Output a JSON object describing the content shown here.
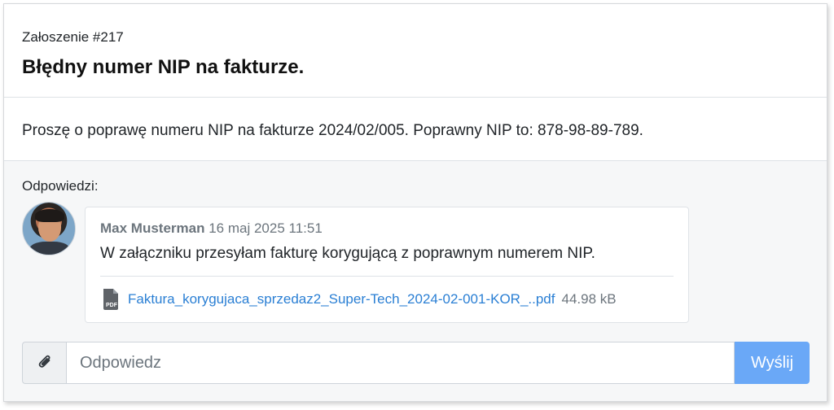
{
  "ticket": {
    "number": "Załoszenie #217",
    "title": "Błędny numer NIP na fakturze.",
    "body": "Proszę o poprawę numeru NIP na fakturze 2024/02/005. Poprawny NIP to: 878-98-89-789."
  },
  "replies": {
    "label": "Odpowiedzi:",
    "items": [
      {
        "author": "Max Musterman",
        "date": "16 maj 2025 11:51",
        "text": "W załączniku przesyłam fakturę korygującą z poprawnym numerem NIP.",
        "attachment": {
          "icon": "pdf-file-icon",
          "filename": "Faktura_korygujaca_sprzedaz2_Super-Tech_2024-02-001-KOR_..pdf",
          "size": "44.98 kB"
        }
      }
    ]
  },
  "reply_form": {
    "attach_icon": "paperclip-icon",
    "placeholder": "Odpowiedz",
    "value": "",
    "send_label": "Wyślij"
  },
  "colors": {
    "accent": "#6aa8f7",
    "link": "#2a7fd4",
    "muted": "#6c757d",
    "replies_background": "#f6f7f8"
  }
}
